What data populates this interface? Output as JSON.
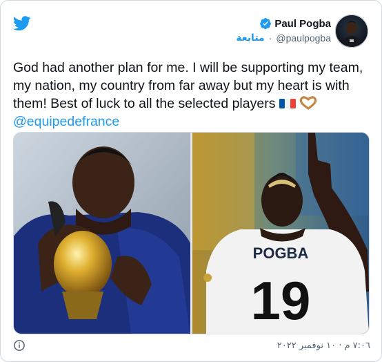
{
  "colors": {
    "accent": "#1d9bf0",
    "secondary_text": "#536471",
    "border": "#cfd9de"
  },
  "header": {
    "logo_icon": "twitter-bird-icon",
    "display_name": "Paul Pogba",
    "verified_icon": "verified-badge-icon",
    "handle": "@paulpogba",
    "separator": "·",
    "follow_label": "متابعة"
  },
  "tweet": {
    "text": "God had another plan for me. I will be supporting my team, my nation, my country from far away but my heart is with them! Best of luck to all the selected players",
    "emojis": [
      "france-flag-emoji",
      "heart-hands-emoji"
    ],
    "mention": "@equipedefrance"
  },
  "media": {
    "images": [
      {
        "name": "player-kissing-trophy-photo"
      },
      {
        "name": "player-pointing-up-photo",
        "jersey_name": "POGBA",
        "jersey_number": "19"
      }
    ]
  },
  "footer": {
    "info_icon": "info-icon",
    "timestamp": "٧:٠٦ م · ١٠ نوفمبر ٢٠٢٢"
  }
}
